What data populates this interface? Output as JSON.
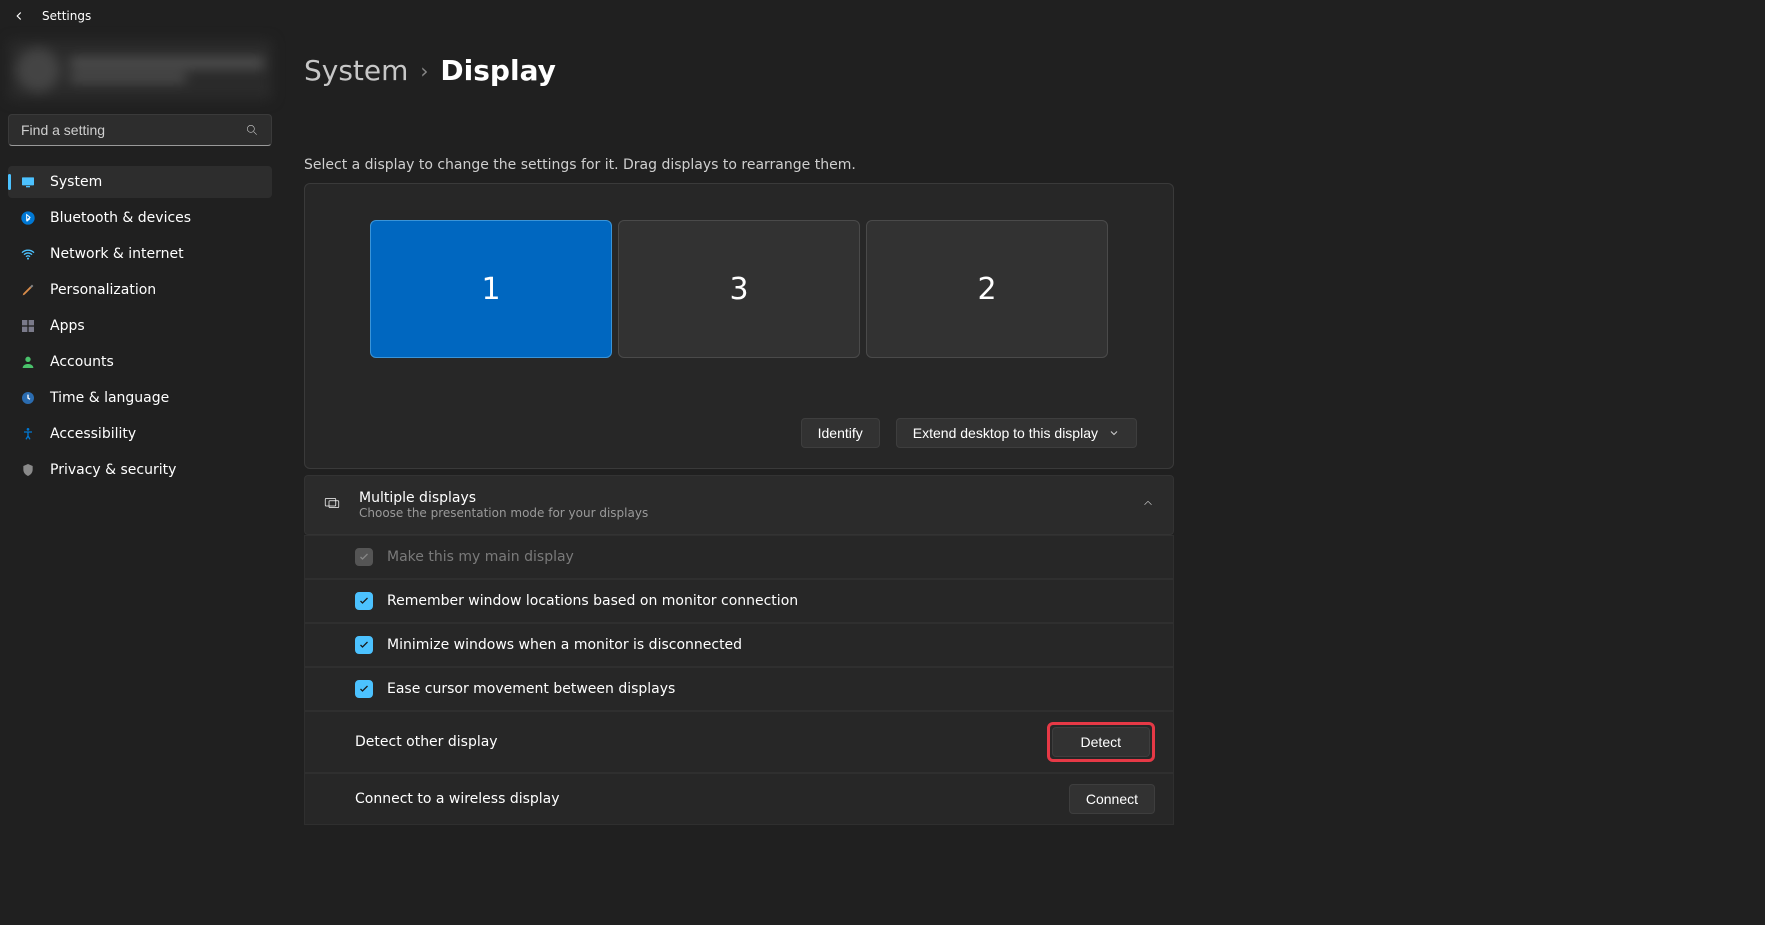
{
  "titlebar": {
    "title": "Settings"
  },
  "search": {
    "placeholder": "Find a setting"
  },
  "sidebar": {
    "items": [
      {
        "label": "System",
        "icon": "system",
        "active": true
      },
      {
        "label": "Bluetooth & devices",
        "icon": "bluetooth"
      },
      {
        "label": "Network & internet",
        "icon": "network"
      },
      {
        "label": "Personalization",
        "icon": "personalization"
      },
      {
        "label": "Apps",
        "icon": "apps"
      },
      {
        "label": "Accounts",
        "icon": "accounts"
      },
      {
        "label": "Time & language",
        "icon": "time"
      },
      {
        "label": "Accessibility",
        "icon": "accessibility"
      },
      {
        "label": "Privacy & security",
        "icon": "privacy"
      }
    ]
  },
  "breadcrumb": {
    "parent": "System",
    "current": "Display"
  },
  "instruction": "Select a display to change the settings for it. Drag displays to rearrange them.",
  "displays": [
    {
      "id": "1",
      "selected": true
    },
    {
      "id": "3",
      "selected": false
    },
    {
      "id": "2",
      "selected": false
    }
  ],
  "identify_label": "Identify",
  "mode_dropdown": "Extend desktop to this display",
  "multiple_displays": {
    "title": "Multiple displays",
    "subtitle": "Choose the presentation mode for your displays"
  },
  "options": {
    "main_display": "Make this my main display",
    "remember_windows": "Remember window locations based on monitor connection",
    "minimize_disconnect": "Minimize windows when a monitor is disconnected",
    "ease_cursor": "Ease cursor movement between displays"
  },
  "detect_row": {
    "label": "Detect other display",
    "button": "Detect"
  },
  "connect_row": {
    "label": "Connect to a wireless display",
    "button": "Connect"
  }
}
